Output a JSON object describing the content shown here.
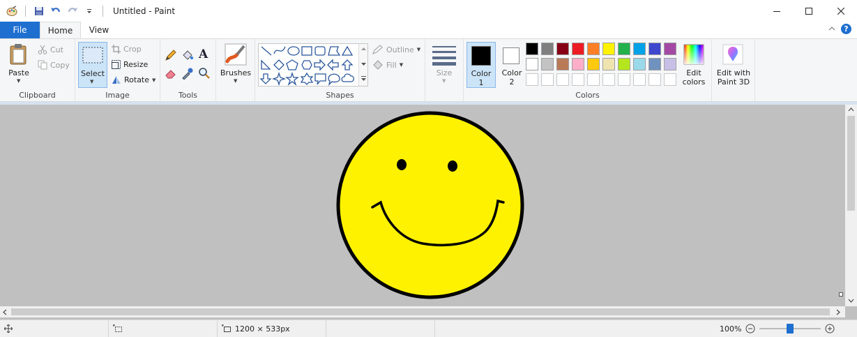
{
  "window": {
    "title": "Untitled - Paint"
  },
  "tabs": {
    "file": "File",
    "home": "Home",
    "view": "View"
  },
  "clipboard": {
    "paste": "Paste",
    "cut": "Cut",
    "copy": "Copy",
    "label": "Clipboard"
  },
  "image": {
    "select": "Select",
    "crop": "Crop",
    "resize": "Resize",
    "rotate": "Rotate",
    "label": "Image"
  },
  "tools": {
    "label": "Tools"
  },
  "brushes": {
    "label": "Brushes"
  },
  "shapes": {
    "outline": "Outline",
    "fill": "Fill",
    "label": "Shapes"
  },
  "size": {
    "label": "Size"
  },
  "colors": {
    "color1": "Color",
    "color1_num": "1",
    "color2": "Color",
    "color2_num": "2",
    "edit": "Edit",
    "edit2": "colors",
    "label": "Colors",
    "palette_row1": [
      "#000000",
      "#7f7f7f",
      "#880015",
      "#ed1c24",
      "#ff7f27",
      "#fff200",
      "#22b14c",
      "#00a2e8",
      "#3f48cc",
      "#a349a4"
    ],
    "palette_row2": [
      "#ffffff",
      "#c3c3c3",
      "#b97a57",
      "#ffaec9",
      "#ffc90e",
      "#efe4b0",
      "#b5e61d",
      "#99d9ea",
      "#7092be",
      "#c8bfe7"
    ],
    "color1_value": "#000000",
    "color2_value": "#ffffff"
  },
  "paint3d": {
    "line1": "Edit with",
    "line2": "Paint 3D"
  },
  "canvas": {
    "face_color": "#fff200",
    "outline_color": "#000000"
  },
  "status": {
    "dimensions": "1200 × 533px",
    "zoom": "100%"
  }
}
